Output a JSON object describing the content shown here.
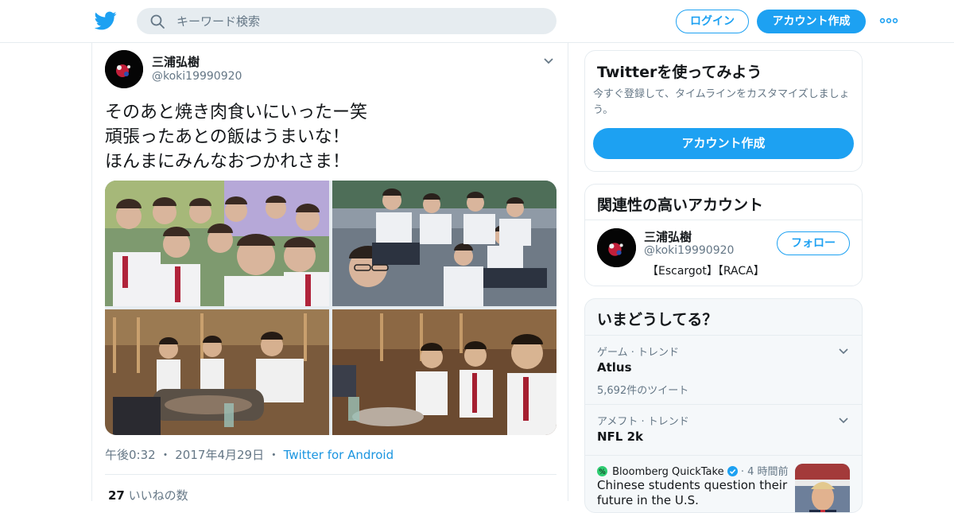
{
  "header": {
    "search_placeholder": "キーワード検索",
    "login_label": "ログイン",
    "signup_label": "アカウント作成",
    "accent": "#1da1f2"
  },
  "tweet": {
    "author_name": "三浦弘樹",
    "author_handle": "@koki19990920",
    "text_lines": [
      "そのあと焼き肉食いにいったー笑",
      "頑張ったあとの飯はうまいな！",
      "ほんまにみんなおつかれさま！"
    ],
    "time": "午後0:32",
    "date": "2017年4月29日",
    "client": "Twitter for Android",
    "likes_count": "27",
    "likes_label": "いいねの数"
  },
  "signup_card": {
    "title": "Twitterを使ってみよう",
    "description": "今すぐ登録して、タイムラインをカスタマイズしましょう。",
    "button_label": "アカウント作成"
  },
  "related_card": {
    "title": "関連性の高いアカウント",
    "account_name": "三浦弘樹",
    "account_handle": "@koki19990920",
    "bio": "【Escargot】【RACA】",
    "follow_label": "フォロー"
  },
  "trends_card": {
    "title": "いまどうしてる？",
    "trends": [
      {
        "context": "ゲーム · トレンド",
        "name": "Atlus",
        "count": "5,692件のツイート"
      },
      {
        "context": "アメフト · トレンド",
        "name": "NFL 2k",
        "count": ""
      }
    ],
    "news": {
      "source": "Bloomberg QuickTake",
      "age": "4 時間前",
      "headline": "Chinese students question their future in the U.S."
    }
  }
}
